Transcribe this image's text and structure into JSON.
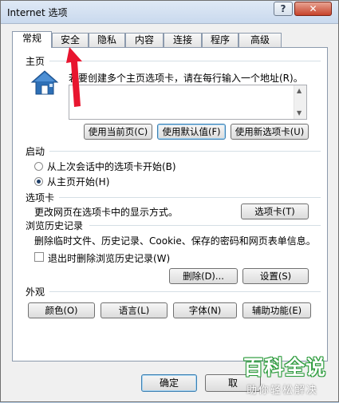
{
  "window": {
    "title": "Internet 选项",
    "help_label": "?",
    "close_label": "✕"
  },
  "tabs": [
    {
      "label": "常规",
      "active": true
    },
    {
      "label": "安全"
    },
    {
      "label": "隐私"
    },
    {
      "label": "内容"
    },
    {
      "label": "连接"
    },
    {
      "label": "程序"
    },
    {
      "label": "高级"
    }
  ],
  "homepage": {
    "heading": "主页",
    "instruction": "若要创建多个主页选项卡，请在每行输入一个地址(R)。",
    "url_value": "",
    "buttons": {
      "use_current": "使用当前页(C)",
      "use_default": "使用默认值(F)",
      "use_new_tab": "使用新选项卡(U)"
    }
  },
  "startup": {
    "heading": "启动",
    "option_last_session": "从上次会话中的选项卡开始(B)",
    "option_homepage": "从主页开始(H)",
    "selected": "option_homepage"
  },
  "tabs_section": {
    "heading": "选项卡",
    "description": "更改网页在选项卡中的显示方式。",
    "button": "选项卡(T)"
  },
  "history": {
    "heading": "浏览历史记录",
    "description": "删除临时文件、历史记录、Cookie、保存的密码和网页表单信息。",
    "checkbox_label": "退出时删除浏览历史记录(W)",
    "delete_button": "删除(D)...",
    "settings_button": "设置(S)"
  },
  "appearance": {
    "heading": "外观",
    "colors": "颜色(O)",
    "languages": "语言(L)",
    "fonts": "字体(N)",
    "accessibility": "辅助功能(E)"
  },
  "footer": {
    "ok": "确定",
    "cancel": "取"
  },
  "watermark": {
    "title": "百科全说",
    "subtitle": "助你轻松解决"
  },
  "colors": {
    "annotation_arrow": "#e8152f",
    "titlebar": "#c9d9ee",
    "close_button": "#c7432b",
    "watermark_green": "#2a9a3a"
  }
}
